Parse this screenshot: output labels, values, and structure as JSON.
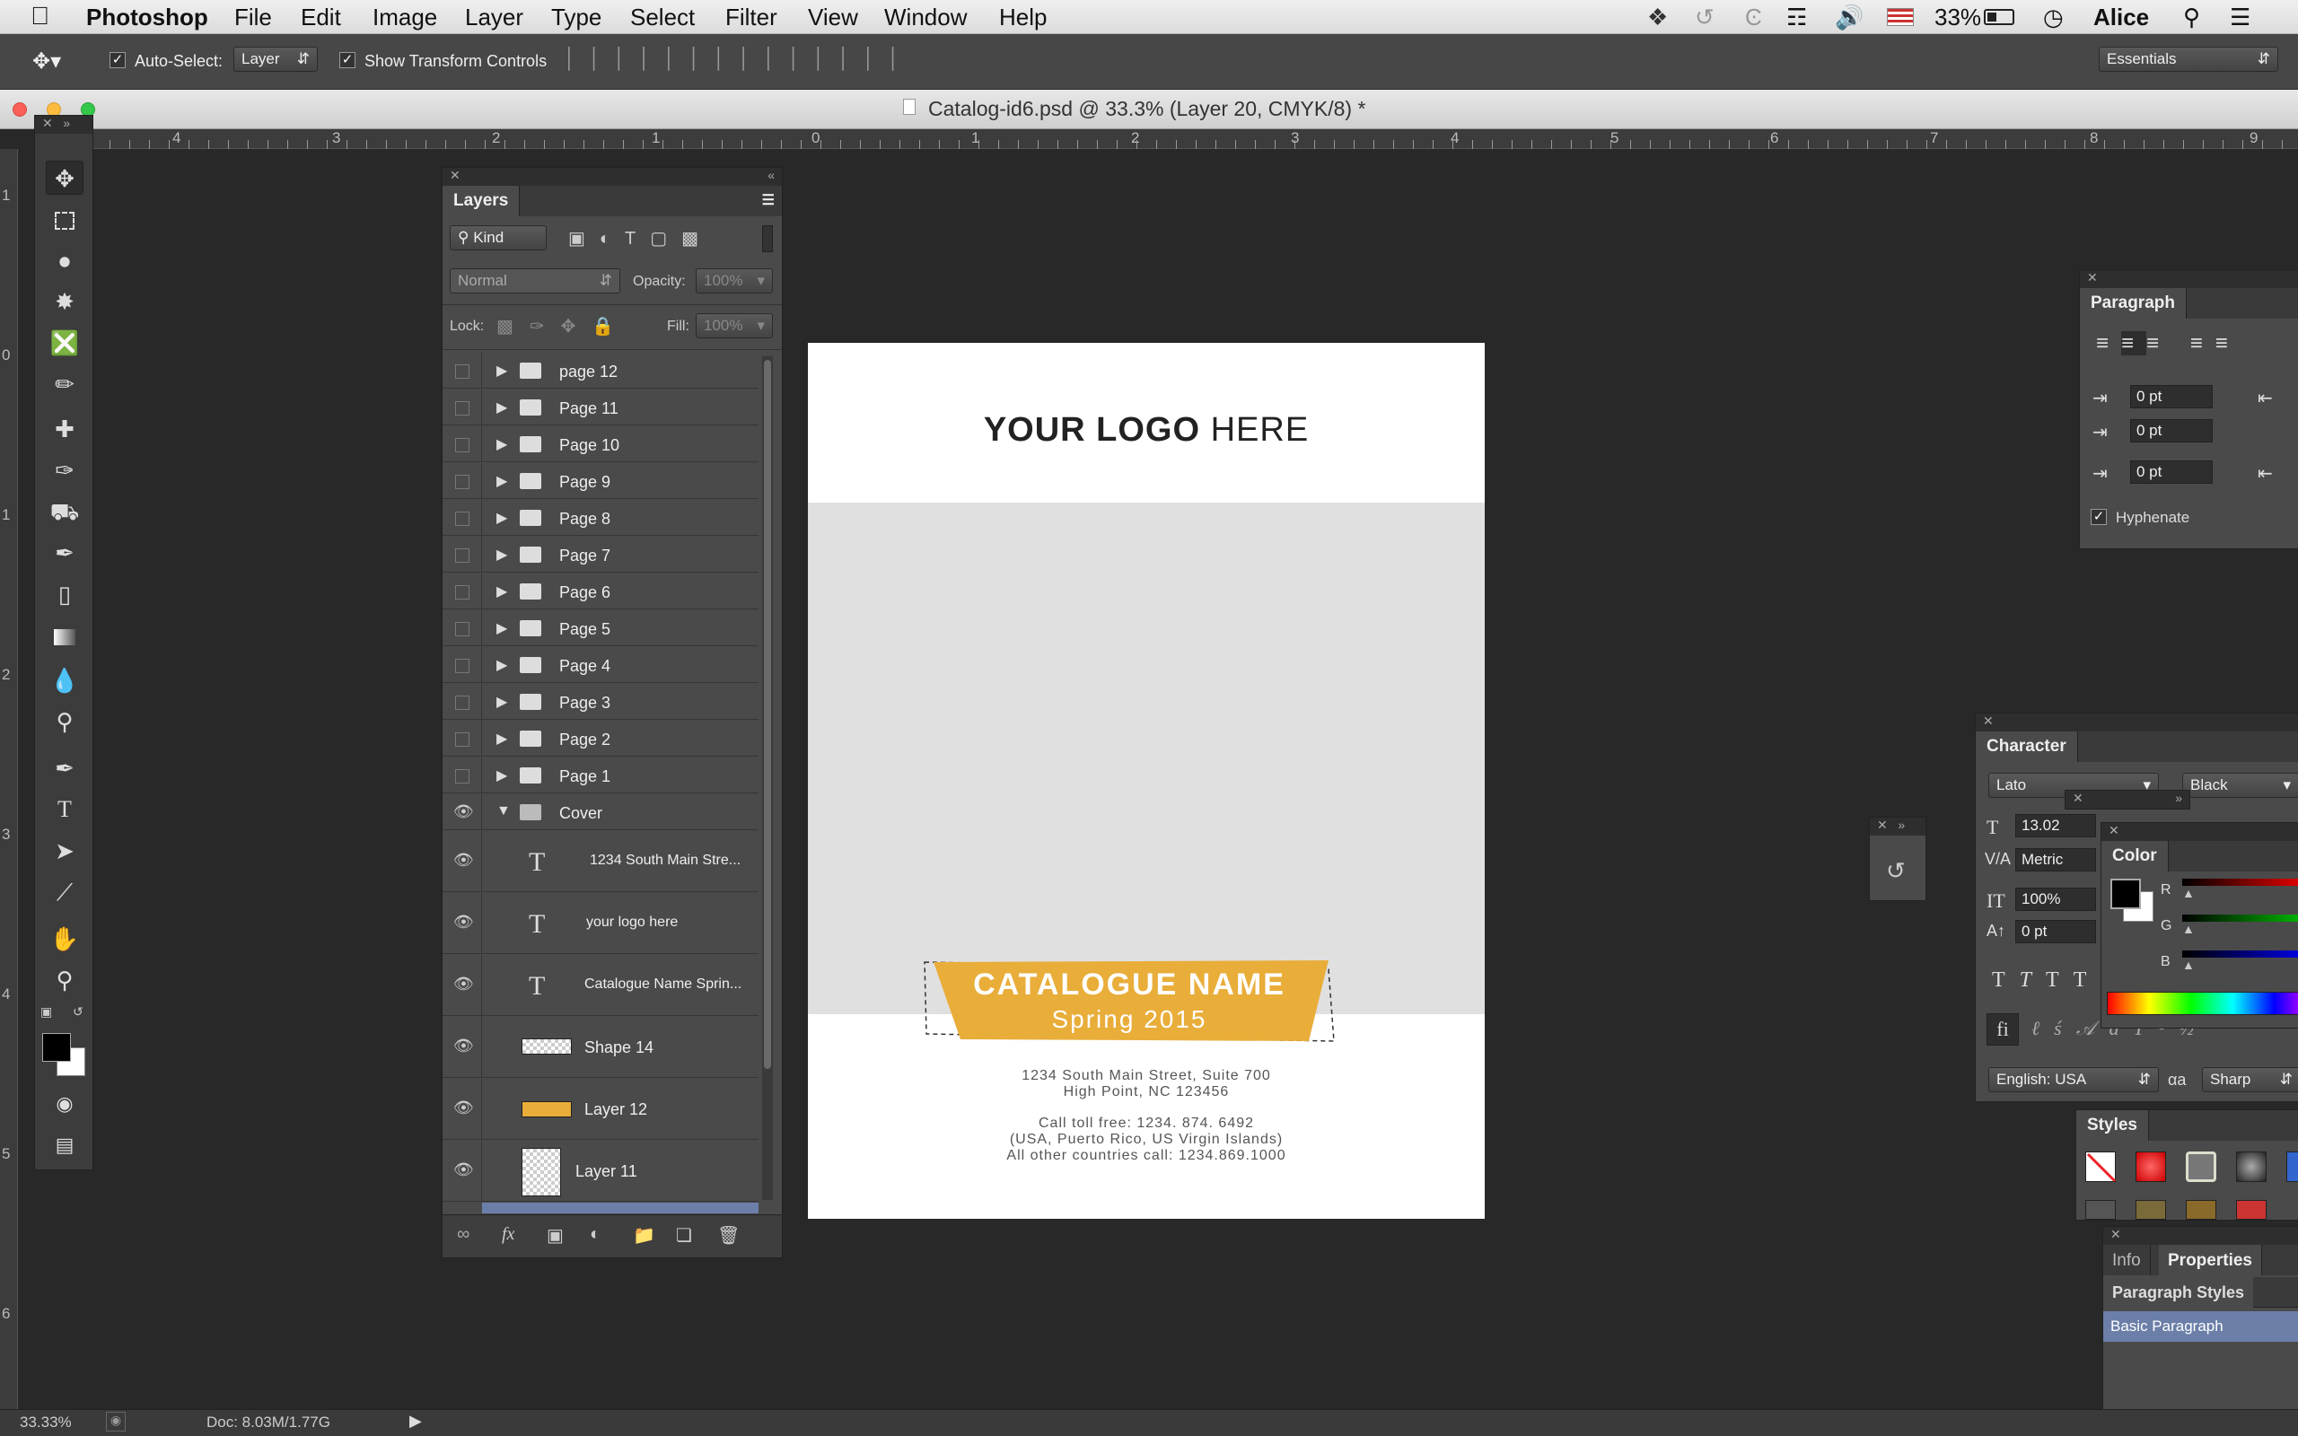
{
  "menubar": {
    "app": "Photoshop",
    "items": [
      "File",
      "Edit",
      "Image",
      "Layer",
      "Type",
      "Select",
      "Filter",
      "View",
      "Window",
      "Help"
    ],
    "battery": "33%",
    "user": "Alice"
  },
  "optbar": {
    "auto_select_label": "Auto-Select:",
    "auto_select_value": "Layer",
    "show_transform_label": "Show Transform Controls",
    "workspace": "Essentials"
  },
  "window": {
    "title": "Catalog-id6.psd @ 33.3% (Layer 20, CMYK/8) *"
  },
  "ruler": {
    "top_ticks": [
      "4",
      "3",
      "2",
      "1",
      "0",
      "1",
      "2",
      "3",
      "4",
      "5",
      "6",
      "7",
      "8",
      "9"
    ],
    "left_ticks": [
      "1",
      "0",
      "1",
      "2",
      "3",
      "4",
      "5",
      "6"
    ]
  },
  "layers": {
    "title": "Layers",
    "filter_label": "Kind",
    "blend_mode": "Normal",
    "opacity_label": "Opacity:",
    "opacity_value": "100%",
    "lock_label": "Lock:",
    "fill_label": "Fill:",
    "fill_value": "100%",
    "groups": [
      "page 12",
      "Page 11",
      "Page 10",
      "Page 9",
      "Page 8",
      "Page 7",
      "Page 6",
      "Page 5",
      "Page 4",
      "Page 3",
      "Page 2",
      "Page 1"
    ],
    "open_group": "Cover",
    "children": [
      {
        "name": "1234 South Main Stre...",
        "kind": "text"
      },
      {
        "name": "your logo here",
        "kind": "text"
      },
      {
        "name": "Catalogue Name Sprin...",
        "kind": "text"
      },
      {
        "name": "Shape 14",
        "kind": "shape"
      },
      {
        "name": "Layer 12",
        "kind": "fill"
      },
      {
        "name": "Layer 11",
        "kind": "transparent"
      }
    ]
  },
  "document": {
    "logo_bold": "YOUR LOGO",
    "logo_light": " HERE",
    "catalogue_name": "CATALOGUE NAME",
    "season": "Spring 2015",
    "address_1": "1234 South Main Street, Suite 700",
    "address_2": "High Point, NC 123456",
    "call_1": "Call toll free: 1234. 874. 6492",
    "call_2": "(USA, Puerto Rico, US Virgin Islands)",
    "call_3": "All other countries call: 1234.869.1000",
    "banner_color": "#e9ad3a"
  },
  "paragraph": {
    "title": "Paragraph",
    "indent_left": "0 pt",
    "indent_first": "0 pt",
    "space_before": "0 pt",
    "hyphenate_label": "Hyphenate"
  },
  "character": {
    "title": "Character",
    "font": "Lato",
    "style": "Black",
    "size": "13.02",
    "kerning": "Metric",
    "vscale": "100%",
    "baseline": "0 pt",
    "language": "English: USA",
    "aa_method": "Sharp"
  },
  "color": {
    "title": "Color",
    "channels": [
      "R",
      "G",
      "B"
    ]
  },
  "styles": {
    "title": "Styles"
  },
  "props": {
    "tab_info": "Info",
    "tab_props": "Properties",
    "para_styles": "Paragraph Styles",
    "basic_para": "Basic Paragraph"
  },
  "status": {
    "zoom": "33.33%",
    "doc": "Doc: 8.03M/1.77G"
  }
}
